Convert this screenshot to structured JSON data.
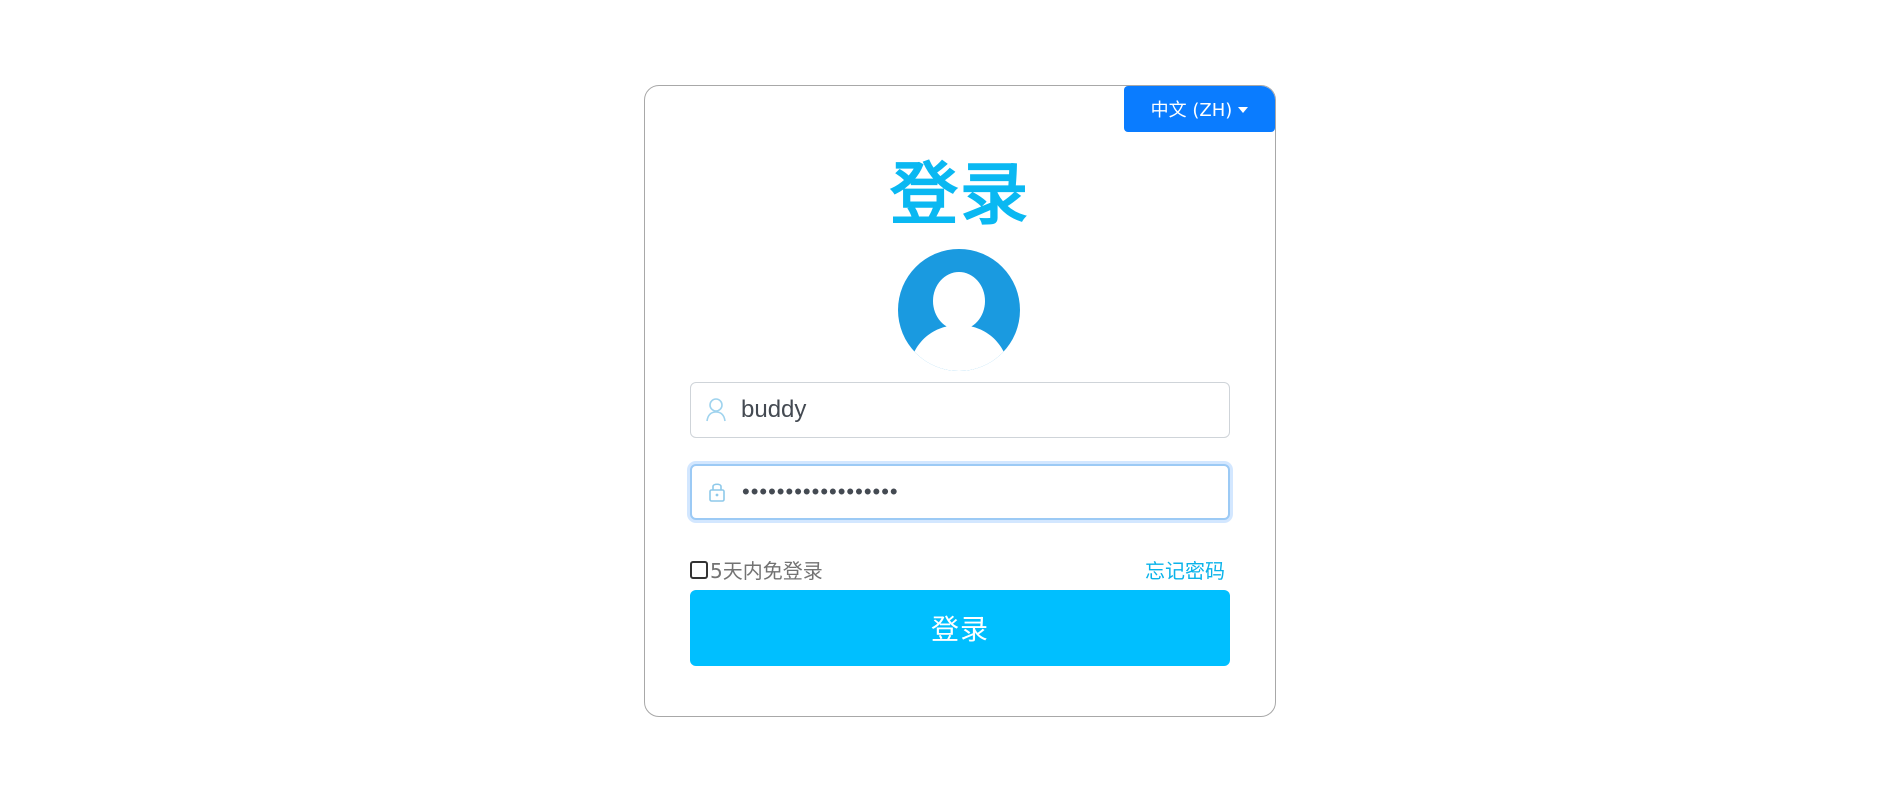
{
  "language_selector": {
    "label": "中文 (ZH)"
  },
  "login_form": {
    "title": "登录",
    "username": {
      "value": "buddy"
    },
    "password": {
      "value": "••••••••••••••••••"
    },
    "remember_label": "5天内免登录",
    "remember_checked": false,
    "forgot_password_label": "忘记密码",
    "submit_label": "登录"
  },
  "colors": {
    "accent": "#00bfff",
    "title": "#0ab8f2",
    "language_button": "#0a7cff",
    "avatar": "#1a9ae0"
  },
  "icons": {
    "username": "user-icon",
    "password": "lock-icon",
    "avatar": "avatar-icon"
  }
}
